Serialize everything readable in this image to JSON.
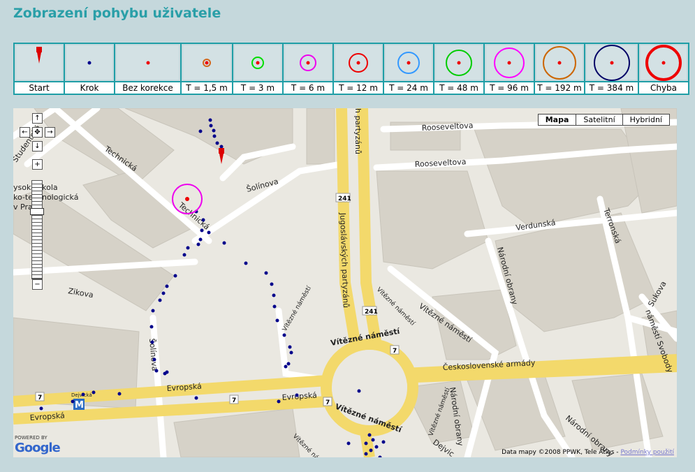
{
  "page": {
    "title": "Zobrazení pohybu uživatele"
  },
  "legend": [
    {
      "label": "Start",
      "kind": "start"
    },
    {
      "label": "Krok",
      "kind": "dot-blue"
    },
    {
      "label": "Bez korekce",
      "kind": "dot-red"
    },
    {
      "label": "T = 1,5 m",
      "kind": "ring",
      "color": "#d2691e",
      "r": 5
    },
    {
      "label": "T = 3 m",
      "kind": "ring",
      "color": "#00dd00",
      "r": 8
    },
    {
      "label": "T = 6 m",
      "kind": "ring",
      "color": "#ee00ee",
      "r": 11
    },
    {
      "label": "T = 12 m",
      "kind": "ring",
      "color": "#ee0000",
      "r": 13
    },
    {
      "label": "T = 24 m",
      "kind": "ring",
      "color": "#3399ff",
      "r": 15
    },
    {
      "label": "T = 48 m",
      "kind": "ring",
      "color": "#00cc00",
      "r": 18
    },
    {
      "label": "T = 96 m",
      "kind": "ring",
      "color": "#ff00ff",
      "r": 21
    },
    {
      "label": "T = 192 m",
      "kind": "ring",
      "color": "#cc6600",
      "r": 23
    },
    {
      "label": "T = 384 m",
      "kind": "ring",
      "color": "#000066",
      "r": 25
    },
    {
      "label": "Chyba",
      "kind": "ring-thick",
      "color": "#ee0000",
      "r": 24
    }
  ],
  "map": {
    "type_buttons": [
      "Mapa",
      "Satelitní",
      "Hybridní"
    ],
    "active_type": "Mapa",
    "attribution": "Data mapy ©2008 PPWK, Tele Atlas -",
    "terms_link": "Podmínky použití",
    "powered_by": "POWERED BY",
    "google": "Google",
    "school_label": [
      "ysoká škola",
      "ko-technologická",
      "v Praze"
    ],
    "streets": {
      "technicka": "Technická",
      "technicka2": "Technická",
      "studentska": "Studentská",
      "solinova": "Šolínova",
      "solinova2": "Šolínova",
      "zikova": "Zikova",
      "evropska1": "Evropská",
      "evropska2": "Evropská",
      "evropska3": "Evropská",
      "jugoslavskych": "Jugoslávských partyzánů",
      "jugoslavskych_top": "h partyzánů",
      "rooseveltova1": "Rooseveltova",
      "rooseveltova2": "Rooseveltova",
      "verdunska": "Verdunská",
      "terronska": "Terronská",
      "narodni_obrany1": "Národní obrany",
      "narodni_obrany2": "Národní obrany",
      "narodni_obrany3": "Národní obrany",
      "sukova": "Sukova",
      "namesti_svobody": "náměstí Svobody",
      "vitezne1": "Vítězné náměstí",
      "vitezne2": "Vítězné náměstí",
      "vitezne3": "Vítězné náměstí",
      "vitezne4": "Vítězné náměstí",
      "vitezne5": "Vítězné náměstí",
      "vitezne6": "Vítězné náměstí",
      "vitezne7": "Vítězné náměstí",
      "ceskoslovenske": "Československé armády",
      "dejvicka": "Dejvická",
      "dejvicka2": "Dejvic",
      "metro": "M",
      "route241a": "241",
      "route241b": "241",
      "route7a": "7",
      "route7b": "7",
      "route7c": "7",
      "route7d": "7"
    }
  }
}
